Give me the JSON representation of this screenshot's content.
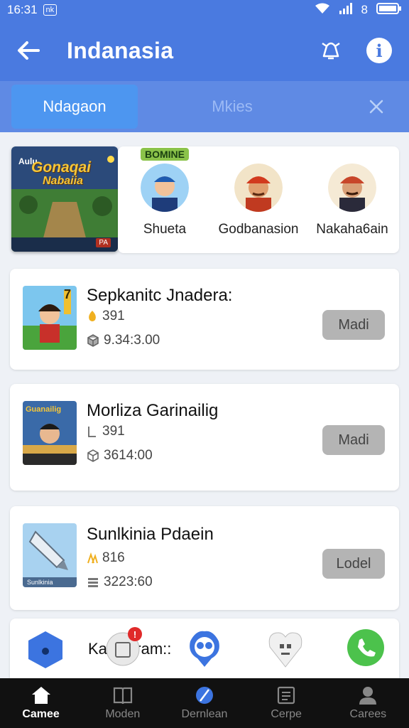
{
  "status": {
    "time": "16:31",
    "badge": "nk",
    "battery_glyph": "8"
  },
  "header": {
    "title": "Indanasia"
  },
  "tabs": [
    {
      "label": "Ndagaon",
      "active": true
    },
    {
      "label": "Mkies",
      "active": false
    }
  ],
  "featured": {
    "banner_title_line1": "Gonaqai",
    "banner_title_line2": "Nabaiia",
    "banner_corner_left": "Aulu",
    "banner_corner_right": "PA",
    "people": [
      {
        "name": "Shueta",
        "avatar_label": "BOMINE"
      },
      {
        "name": "Godbanasion"
      },
      {
        "name": "Nakaha6ain"
      }
    ]
  },
  "games": [
    {
      "title": "Sepkanitc Jnadera:",
      "coin_count": "391",
      "stat": "9.34:3.00",
      "button": "Madi",
      "thumb_label": "7"
    },
    {
      "title": "Morliza Garinailig",
      "coin_count": "391",
      "stat": "3614:00",
      "button": "Madi",
      "thumb_label": "Guanailig"
    },
    {
      "title": "Sunlkinia Pdaein",
      "coin_count": "816",
      "stat": "3223:60",
      "button": "Lodel",
      "thumb_label": "Sunlkinia"
    }
  ],
  "partial_card": {
    "text": "Kalekaram::",
    "badge": "!"
  },
  "bottom_nav": [
    {
      "label": "Camee",
      "icon": "home-icon",
      "active": true
    },
    {
      "label": "Moden",
      "icon": "book-icon",
      "active": false
    },
    {
      "label": "Dernlean",
      "icon": "compass-icon",
      "active": false
    },
    {
      "label": "Cerpe",
      "icon": "folder-icon",
      "active": false
    },
    {
      "label": "Carees",
      "icon": "person-icon",
      "active": false
    }
  ],
  "colors": {
    "app_bar": "#4a7ae0",
    "tab_active": "#4d96f0",
    "button_gray": "#b4b4b4",
    "nav_background": "#111111"
  }
}
